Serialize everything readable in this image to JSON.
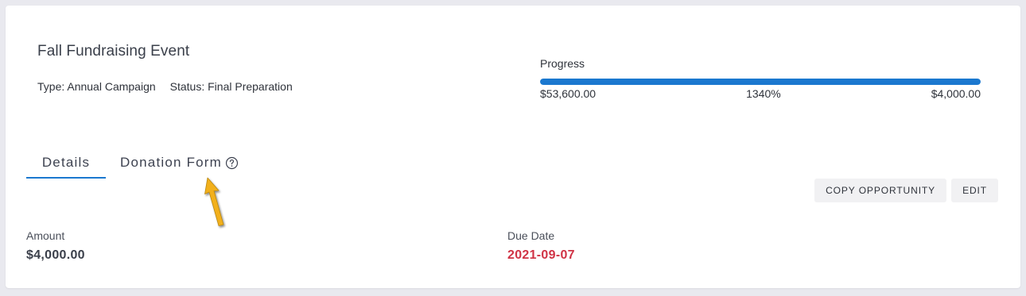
{
  "opportunity": {
    "title": "Fall Fundraising Event",
    "type_text": "Type: Annual Campaign",
    "status_text": "Status: Final Preparation"
  },
  "progress": {
    "label": "Progress",
    "raised": "$53,600.00",
    "percent_text": "1340%",
    "goal": "$4,000.00",
    "fill_fraction": 1.0,
    "bar_color": "#1b78cf"
  },
  "tabs": [
    {
      "label": "Details",
      "active": true
    },
    {
      "label": "Donation Form",
      "icon": "help-circle-icon"
    }
  ],
  "actions": {
    "copy_label": "COPY OPPORTUNITY",
    "edit_label": "EDIT"
  },
  "fields": {
    "amount": {
      "label": "Amount",
      "value": "$4,000.00"
    },
    "due_date": {
      "label": "Due Date",
      "value": "2021-09-07",
      "color": "#d03345"
    }
  },
  "annotation": {
    "icon": "arrow-pointer-icon",
    "color": "#f2b01e"
  }
}
